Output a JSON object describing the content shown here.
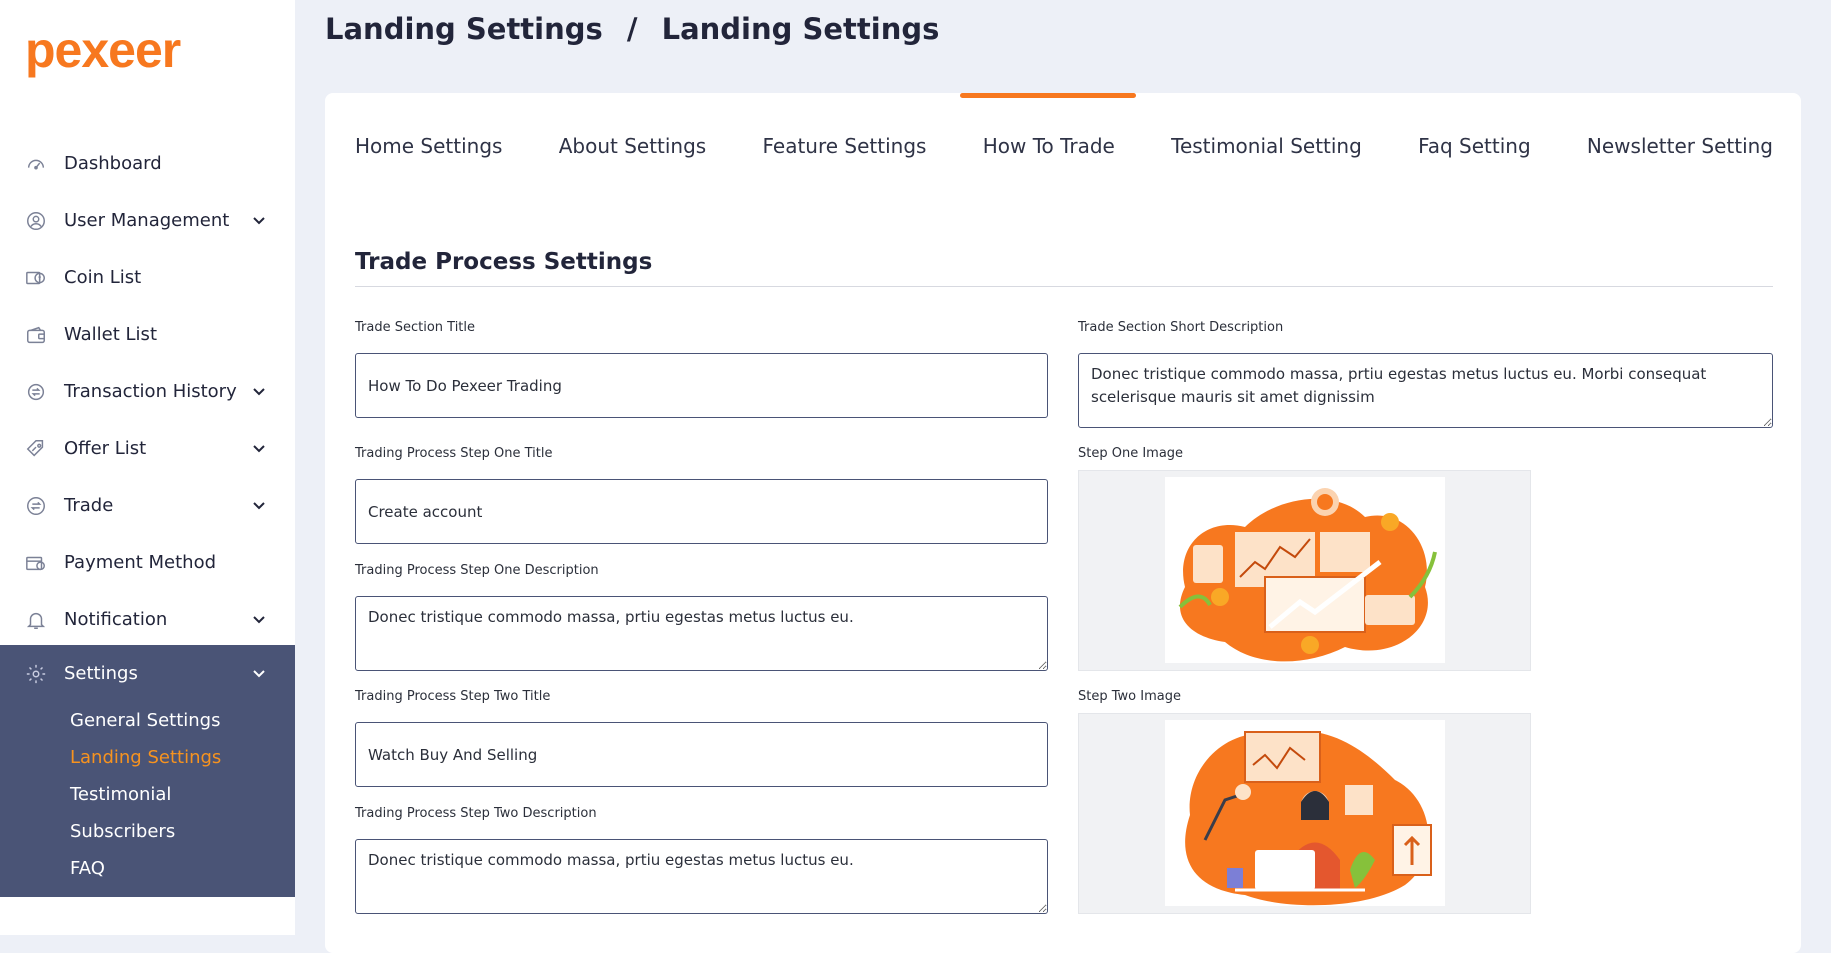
{
  "brand": {
    "logo_text": "pexeer",
    "color": "#f7781f"
  },
  "sidebar": {
    "items": [
      {
        "label": "Dashboard",
        "icon": "dashboard-icon",
        "has_children": false
      },
      {
        "label": "User Management",
        "icon": "user-icon",
        "has_children": true
      },
      {
        "label": "Coin List",
        "icon": "coin-icon",
        "has_children": false
      },
      {
        "label": "Wallet List",
        "icon": "wallet-icon",
        "has_children": false
      },
      {
        "label": "Transaction History",
        "icon": "transaction-icon",
        "has_children": true
      },
      {
        "label": "Offer List",
        "icon": "offer-icon",
        "has_children": true
      },
      {
        "label": "Trade",
        "icon": "trade-icon",
        "has_children": true
      },
      {
        "label": "Payment Method",
        "icon": "payment-icon",
        "has_children": false
      },
      {
        "label": "Notification",
        "icon": "bell-icon",
        "has_children": true
      }
    ],
    "settings": {
      "label": "Settings",
      "icon": "gear-icon",
      "children": [
        {
          "label": "General Settings",
          "active": false
        },
        {
          "label": "Landing Settings",
          "active": true
        },
        {
          "label": "Testimonial",
          "active": false
        },
        {
          "label": "Subscribers",
          "active": false
        },
        {
          "label": "FAQ",
          "active": false
        }
      ]
    }
  },
  "header": {
    "breadcrumb_parent": "Landing Settings",
    "separator": "/",
    "breadcrumb_current": "Landing Settings"
  },
  "tabs": [
    {
      "label": "Home Settings",
      "active": false
    },
    {
      "label": "About Settings",
      "active": false
    },
    {
      "label": "Feature Settings",
      "active": false
    },
    {
      "label": "How To Trade",
      "active": true
    },
    {
      "label": "Testimonial Setting",
      "active": false
    },
    {
      "label": "Faq Setting",
      "active": false
    },
    {
      "label": "Newsletter Setting",
      "active": false
    }
  ],
  "form": {
    "section_title": "Trade Process Settings",
    "trade_title": {
      "label": "Trade Section Title",
      "value": "How To Do Pexeer Trading"
    },
    "trade_short_desc": {
      "label": "Trade Section Short Description",
      "value": "Donec tristique commodo massa, prtiu egestas metus luctus eu. Morbi consequat scelerisque mauris sit amet dignissim"
    },
    "step_one_title": {
      "label": "Trading Process Step One Title",
      "value": "Create account"
    },
    "step_one_desc": {
      "label": "Trading Process Step One Description",
      "value": "Donec tristique commodo massa, prtiu egestas metus luctus eu."
    },
    "step_two_title": {
      "label": "Trading Process Step Two Title",
      "value": "Watch Buy And Selling"
    },
    "step_two_desc": {
      "label": "Trading Process Step Two Description",
      "value": "Donec tristique commodo massa, prtiu egestas metus luctus eu."
    },
    "step_one_image": {
      "label": "Step One Image"
    },
    "step_two_image": {
      "label": "Step Two Image"
    }
  },
  "colors": {
    "accent": "#f7781f",
    "sidebar_active_bg": "#4a5476",
    "active_sub": "#f7931f"
  }
}
